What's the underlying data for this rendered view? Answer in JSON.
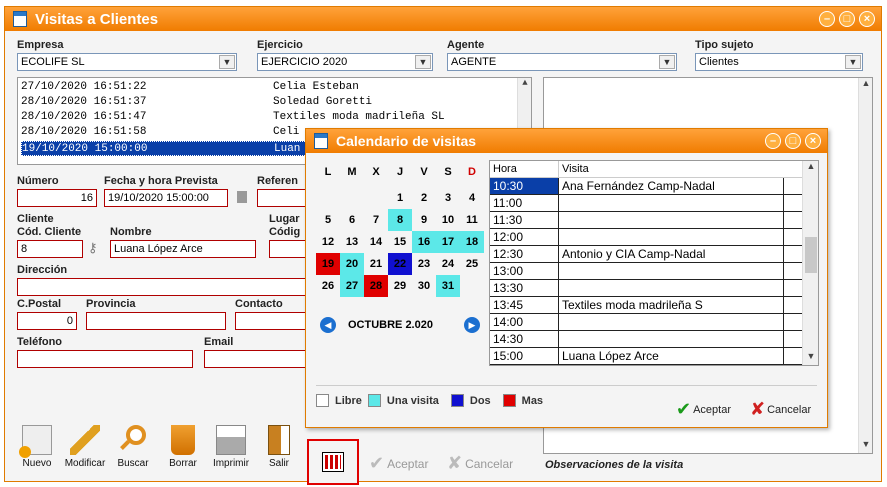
{
  "window": {
    "title": "Visitas a Clientes"
  },
  "filters": {
    "empresa": {
      "label": "Empresa",
      "value": "ECOLIFE SL"
    },
    "ejercicio": {
      "label": "Ejercicio",
      "value": "EJERCICIO 2020"
    },
    "agente": {
      "label": "Agente",
      "value": "AGENTE"
    },
    "tipo": {
      "label": "Tipo sujeto",
      "value": "Clientes"
    }
  },
  "visits": [
    {
      "datetime": "27/10/2020 16:51:22",
      "name": "Celia Esteban"
    },
    {
      "datetime": "28/10/2020 16:51:37",
      "name": "Soledad Goretti"
    },
    {
      "datetime": "28/10/2020 16:51:47",
      "name": "Textiles moda madrileña SL"
    },
    {
      "datetime": "28/10/2020 16:51:58",
      "name": "Celi"
    },
    {
      "datetime": "19/10/2020 15:00:00",
      "name": "Luan"
    }
  ],
  "form": {
    "numero_label": "Número",
    "numero": "16",
    "fecha_label": "Fecha y hora Prevista",
    "fecha": "19/10/2020 15:00:00",
    "referencia_label": "Referen",
    "cliente_label": "Cliente",
    "cod_label": "Cód. Cliente",
    "cod": "8",
    "nombre_label": "Nombre",
    "nombre": "Luana López Arce",
    "lugar_label": "Lugar",
    "codigo_label": "Códig",
    "direccion_label": "Dirección",
    "cpostal_label": "C.Postal",
    "cpostal": "0",
    "provincia_label": "Provincia",
    "contacto_label": "Contacto",
    "telefono_label": "Teléfono",
    "email_label": "Email"
  },
  "toolbar": {
    "nuevo": "Nuevo",
    "modificar": "Modificar",
    "buscar": "Buscar",
    "borrar": "Borrar",
    "imprimir": "Imprimir",
    "salir": "Salir",
    "aceptar": "Aceptar",
    "cancelar": "Cancelar"
  },
  "notes_label": "Observaciones de la visita",
  "calendar": {
    "title": "Calendario de visitas",
    "weekdays": [
      "L",
      "M",
      "X",
      "J",
      "V",
      "S",
      "D"
    ],
    "month": "OCTUBRE 2.020",
    "weeks": [
      [
        "",
        "",
        "",
        "1",
        "2",
        "3",
        "4"
      ],
      [
        "5",
        "6",
        "7",
        "8",
        "9",
        "10",
        "11"
      ],
      [
        "12",
        "13",
        "14",
        "15",
        "16",
        "17",
        "18"
      ],
      [
        "19",
        "20",
        "21",
        "22",
        "23",
        "24",
        "25"
      ],
      [
        "26",
        "27",
        "28",
        "29",
        "30",
        "31",
        ""
      ]
    ],
    "colors": {
      "libre": "#ffffff",
      "una": "#5ce8e8",
      "dos": "#1010d0",
      "mas": "#e00000"
    },
    "marks": {
      "8": "una",
      "16": "una",
      "17": "una",
      "18": "una",
      "19": "mas",
      "20": "una",
      "22": "dos",
      "27": "una",
      "28": "mas",
      "31": "una"
    },
    "schedule_header": {
      "hora": "Hora",
      "visita": "Visita"
    },
    "schedule": [
      {
        "hora": "10:30",
        "visita": "Ana Fernández Camp-Nadal"
      },
      {
        "hora": "11:00",
        "visita": ""
      },
      {
        "hora": "11:30",
        "visita": ""
      },
      {
        "hora": "12:00",
        "visita": ""
      },
      {
        "hora": "12:30",
        "visita": "Antonio y CIA Camp-Nadal"
      },
      {
        "hora": "13:00",
        "visita": ""
      },
      {
        "hora": "13:30",
        "visita": ""
      },
      {
        "hora": "13:45",
        "visita": "Textiles moda madrileña S"
      },
      {
        "hora": "14:00",
        "visita": ""
      },
      {
        "hora": "14:30",
        "visita": ""
      },
      {
        "hora": "15:00",
        "visita": "Luana López Arce"
      }
    ],
    "legend": {
      "libre": "Libre",
      "una": "Una visita",
      "dos": "Dos",
      "mas": "Mas"
    },
    "aceptar": "Aceptar",
    "cancelar": "Cancelar"
  }
}
